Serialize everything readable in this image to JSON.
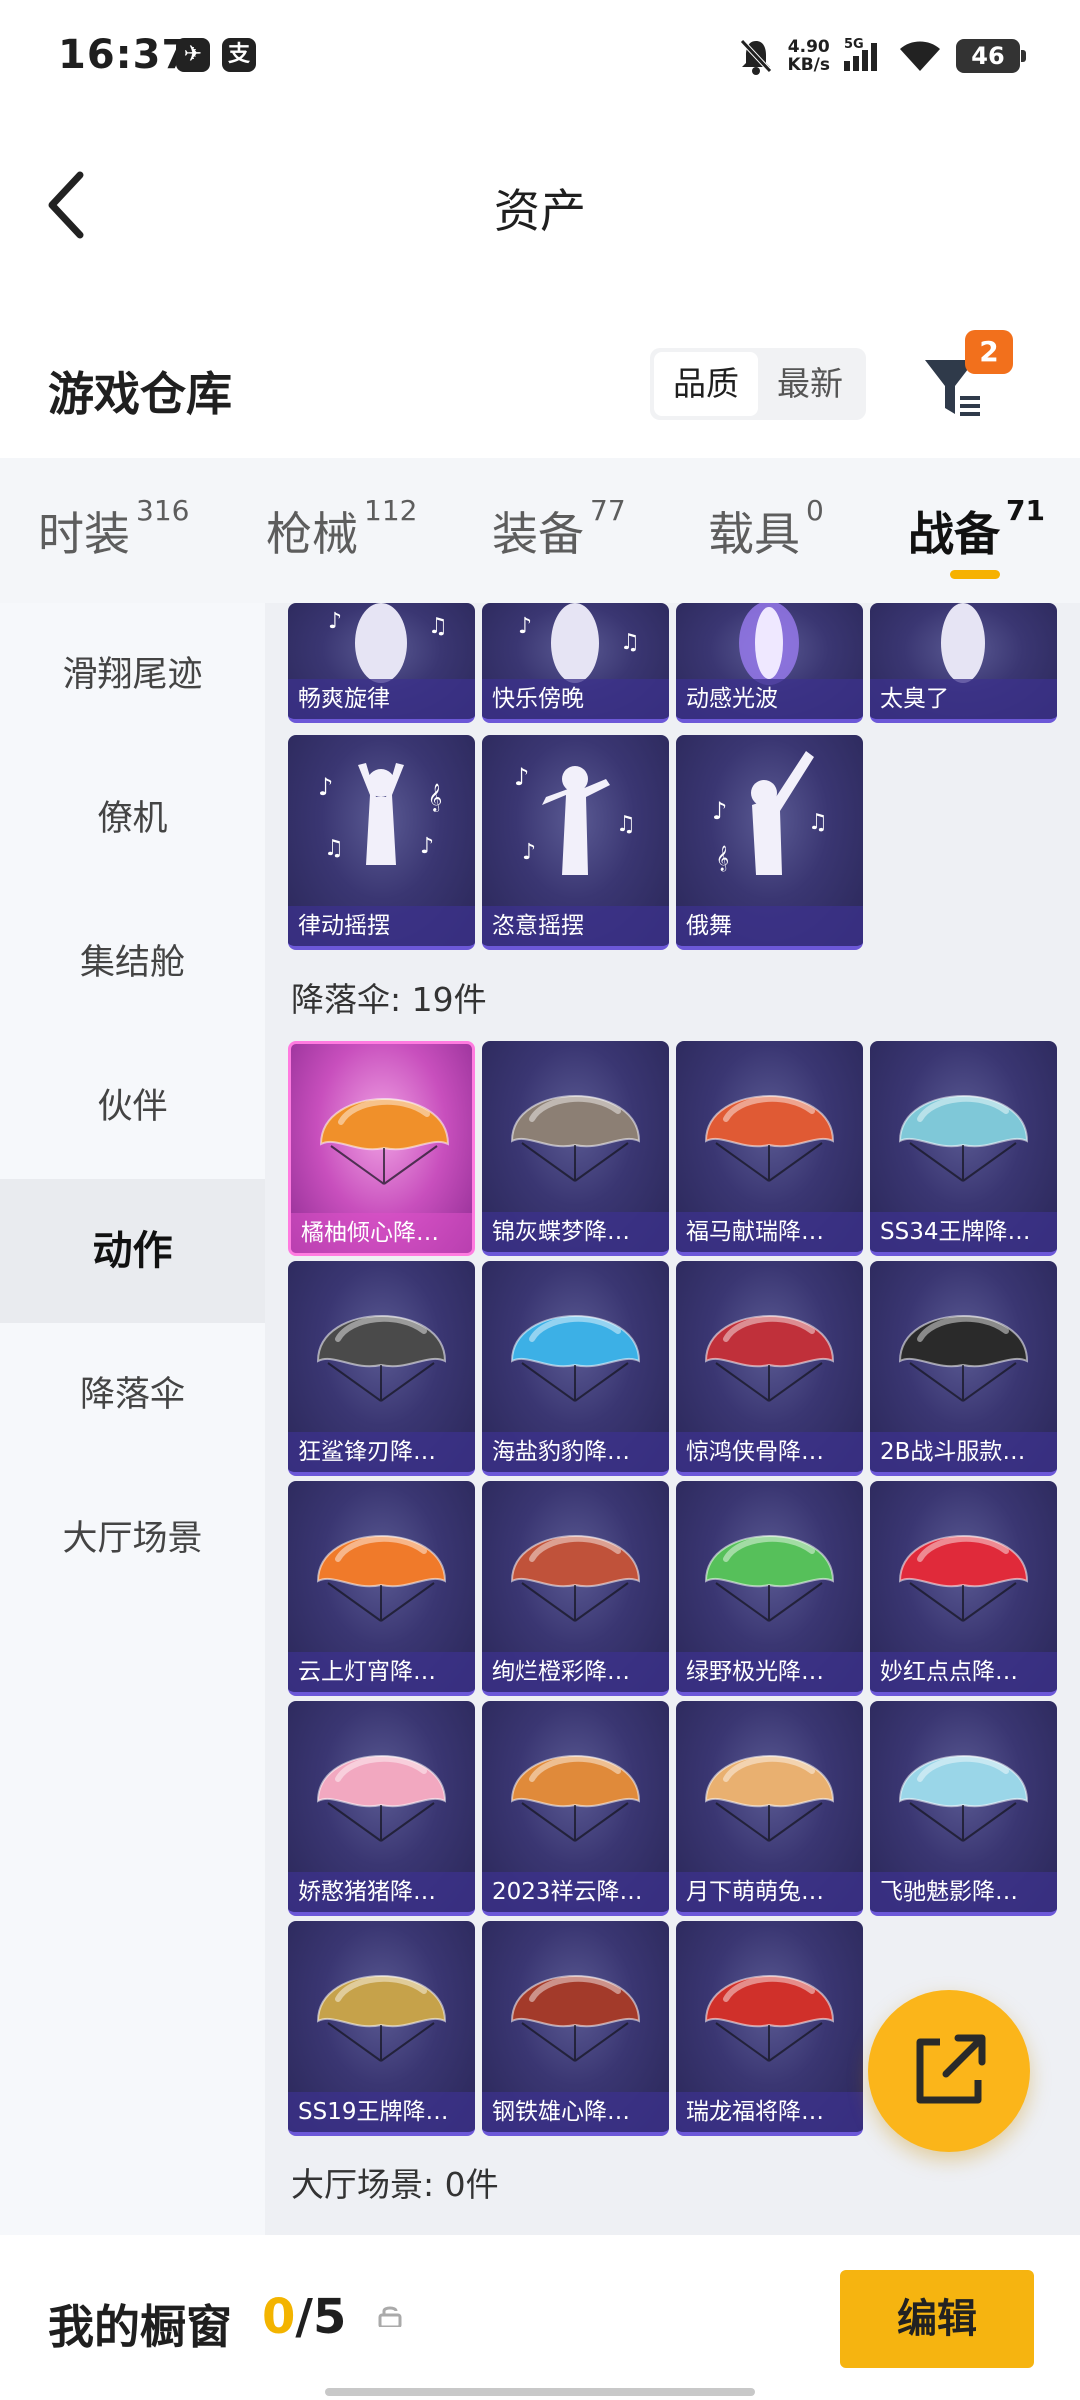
{
  "status_bar": {
    "time": "16:37",
    "app_icons": [
      "telegram-icon",
      "alipay-icon"
    ],
    "net_speed_value": "4.90",
    "net_speed_unit": "KB/s",
    "network_label": "5G",
    "battery": "46"
  },
  "header": {
    "title": "资产"
  },
  "warehouse": {
    "title": "游戏仓库",
    "sort_options": [
      "品质",
      "最新"
    ],
    "selected_sort": "品质",
    "filter_badge": "2"
  },
  "categories": [
    {
      "label": "时装",
      "count": "316"
    },
    {
      "label": "枪械",
      "count": "112"
    },
    {
      "label": "装备",
      "count": "77"
    },
    {
      "label": "载具",
      "count": "0"
    },
    {
      "label": "战备",
      "count": "71"
    }
  ],
  "active_category": "战备",
  "sidebar": {
    "items": [
      {
        "label": "滑翔尾迹"
      },
      {
        "label": "僚机"
      },
      {
        "label": "集结舱"
      },
      {
        "label": "伙伴"
      },
      {
        "label": "动作"
      },
      {
        "label": "降落伞"
      },
      {
        "label": "大厅场景"
      }
    ],
    "active": "动作"
  },
  "emotes": [
    {
      "name": "畅爽旋律"
    },
    {
      "name": "快乐傍晚"
    },
    {
      "name": "动感光波"
    },
    {
      "name": "太臭了"
    },
    {
      "name": "律动摇摆"
    },
    {
      "name": "恣意摇摆"
    },
    {
      "name": "俄舞"
    }
  ],
  "parachute_section": {
    "title": "降落伞: 19件"
  },
  "parachutes": [
    {
      "name": "橘柚倾心降…",
      "color": "#f0902a"
    },
    {
      "name": "锦灰蝶梦降…",
      "color": "#8c7f74"
    },
    {
      "name": "福马献瑞降…",
      "color": "#e05a34"
    },
    {
      "name": "SS34王牌降…",
      "color": "#7fc8d8"
    },
    {
      "name": "狂鲨锋刃降…",
      "color": "#4a4a4a"
    },
    {
      "name": "海盐豹豹降…",
      "color": "#3cb0e6"
    },
    {
      "name": "惊鸿侠骨降…",
      "color": "#c0303a"
    },
    {
      "name": "2B战斗服款…",
      "color": "#2a2a2a"
    },
    {
      "name": "云上灯宵降…",
      "color": "#f07a2a"
    },
    {
      "name": "绚烂橙彩降…",
      "color": "#c0523a"
    },
    {
      "name": "绿野极光降…",
      "color": "#56c05a"
    },
    {
      "name": "妙红点点降…",
      "color": "#e02a3a"
    },
    {
      "name": "娇憨猪猪降…",
      "color": "#f2a8c0"
    },
    {
      "name": "2023祥云降…",
      "color": "#e08a3a"
    },
    {
      "name": "月下萌萌兔…",
      "color": "#e9b070"
    },
    {
      "name": "飞驰魅影降…",
      "color": "#9ad6e8"
    },
    {
      "name": "SS19王牌降…",
      "color": "#c6a24a"
    },
    {
      "name": "钢铁雄心降…",
      "color": "#a33a2a"
    },
    {
      "name": "瑞龙福将降…",
      "color": "#d0302a"
    }
  ],
  "lobby_section": {
    "title": "大厅场景: 0件"
  },
  "showcase": {
    "label": "我的橱窗",
    "used": "0",
    "total_text": "/5",
    "edit_label": "编辑"
  },
  "colors": {
    "accent": "#f6b410",
    "badge": "#f2701c",
    "card_base": "#3a3672"
  }
}
